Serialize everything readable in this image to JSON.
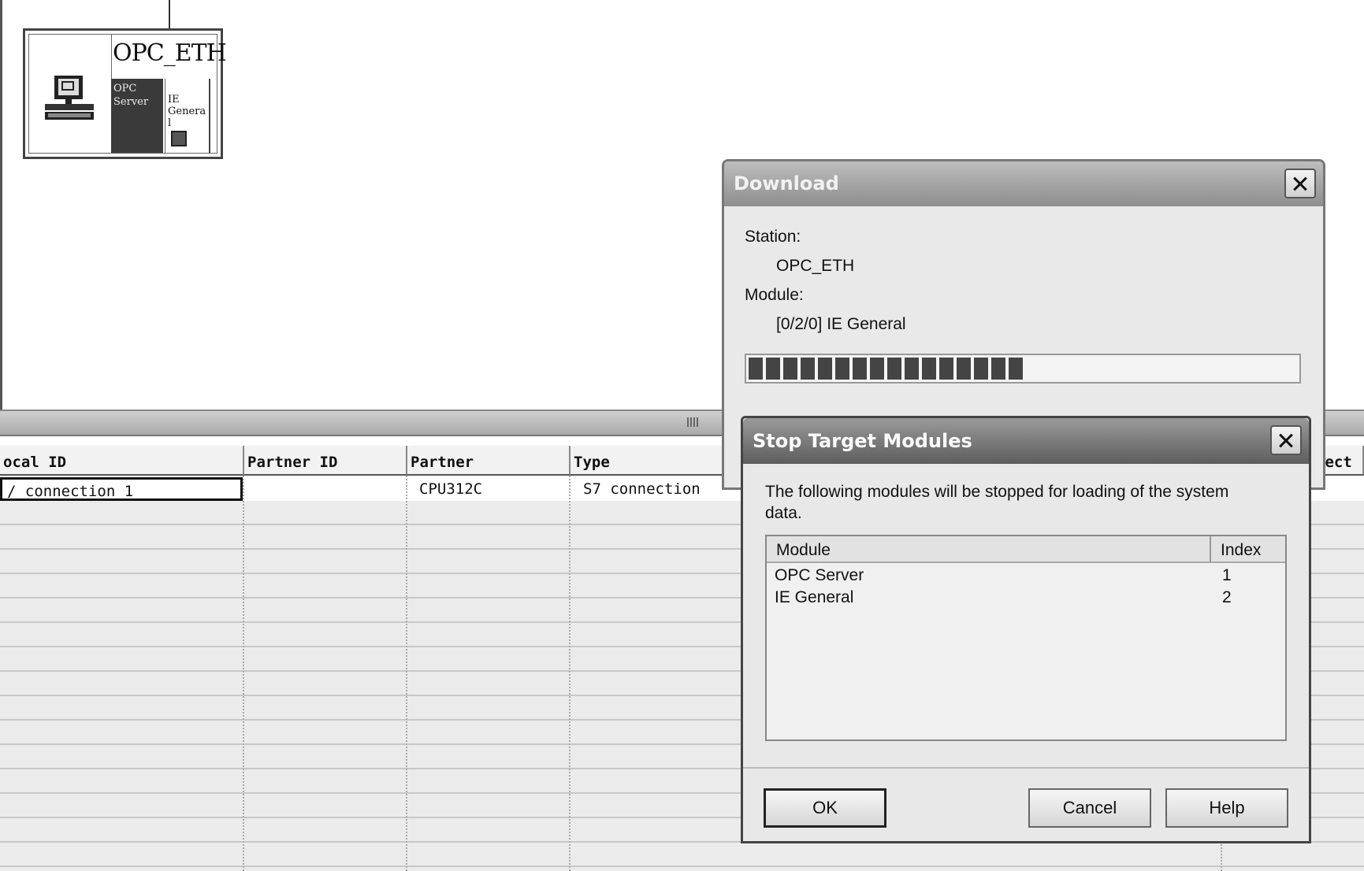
{
  "network_view": {
    "station": {
      "name": "OPC_ETH",
      "icon": "pc-station-icon",
      "slots": [
        {
          "label": "OPC\nServer"
        },
        {
          "label": "IE\nGenera\nl"
        }
      ]
    }
  },
  "connection_table": {
    "headers": [
      "ocal ID",
      "Partner ID",
      "Partner",
      "Type",
      "nect"
    ],
    "rows": [
      {
        "local_id": "/ connection_1",
        "partner_id": "",
        "partner": "CPU312C",
        "type": "S7 connection"
      }
    ]
  },
  "download_dialog": {
    "title": "Download",
    "station_label": "Station:",
    "station_value": "OPC_ETH",
    "module_label": "Module:",
    "module_value": "[0/2/0] IE General",
    "progress": 0.52
  },
  "stop_dialog": {
    "title": "Stop Target Modules",
    "message": "The following modules will be stopped for loading of the system data.",
    "columns": [
      "Module",
      "Index"
    ],
    "modules": [
      {
        "module": "OPC Server",
        "index": "1"
      },
      {
        "module": "IE General",
        "index": "2"
      }
    ],
    "buttons": {
      "ok": "OK",
      "cancel": "Cancel",
      "help": "Help"
    }
  }
}
